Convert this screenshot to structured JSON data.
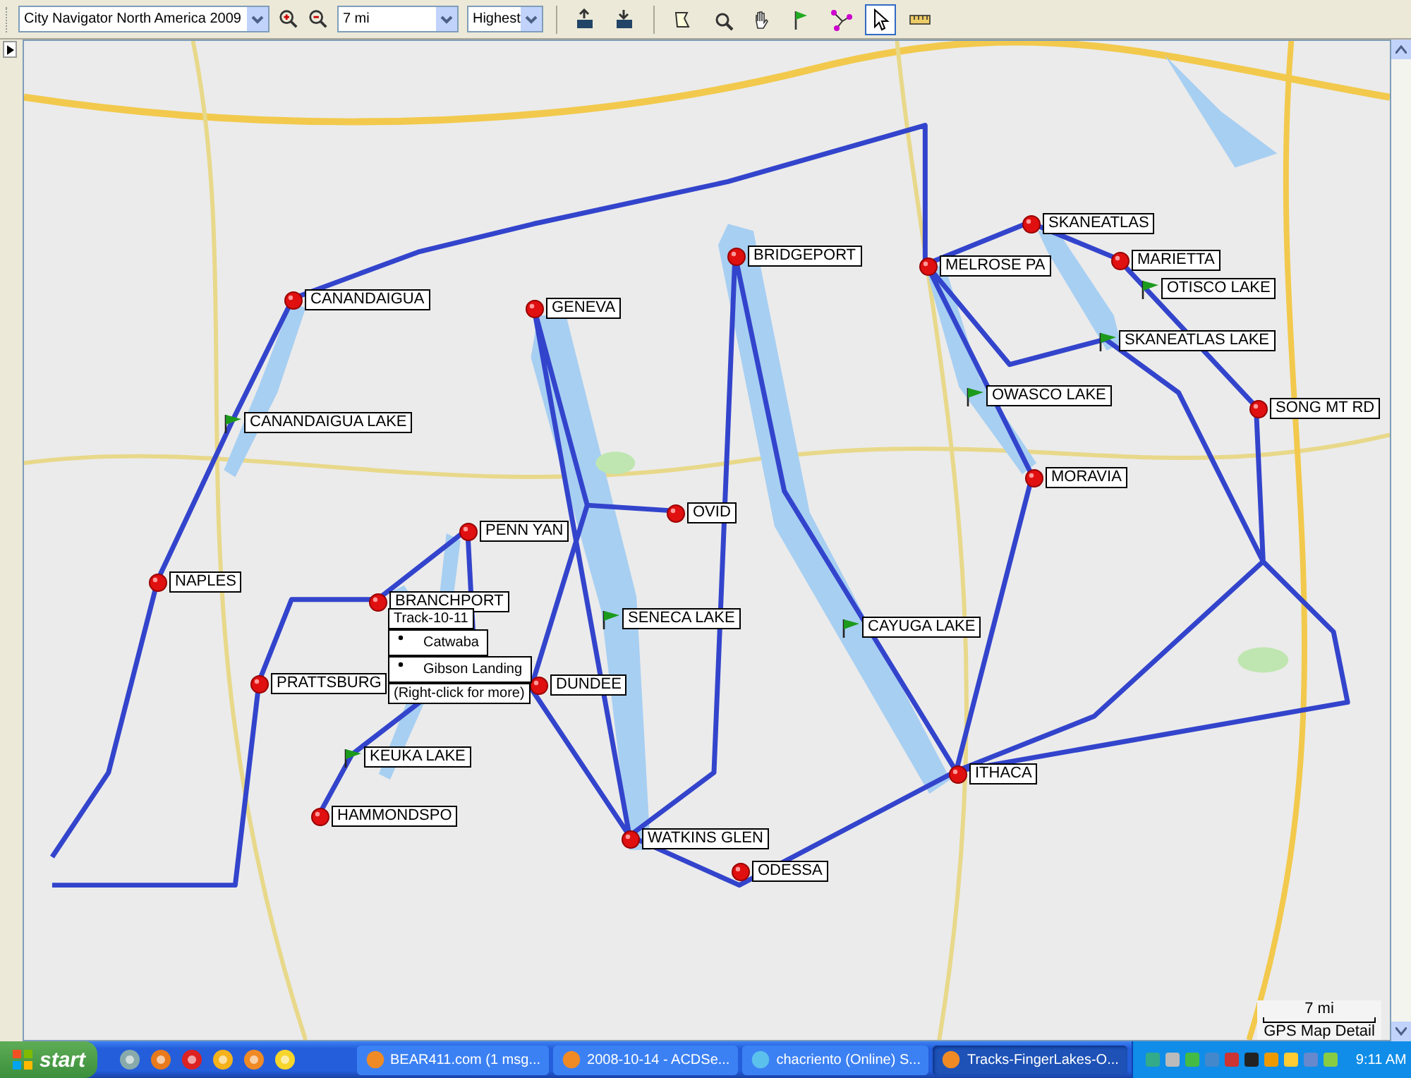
{
  "toolbar": {
    "map_product": "City Navigator North America 2009",
    "zoom_level": "7 mi",
    "detail": "Highest",
    "tools": [
      {
        "kind": "send",
        "selected": false
      },
      {
        "kind": "receive",
        "selected": false
      },
      {
        "kind": "polygon",
        "selected": false
      },
      {
        "kind": "zoom",
        "selected": false
      },
      {
        "kind": "hand",
        "selected": false
      },
      {
        "kind": "flag",
        "selected": false
      },
      {
        "kind": "route",
        "selected": false
      },
      {
        "kind": "pointer",
        "selected": true
      },
      {
        "kind": "ruler",
        "selected": false
      }
    ]
  },
  "map": {
    "kind": "picture",
    "waypoints": [
      {
        "label": "CANANDAIGUA",
        "kind": "city"
      },
      {
        "label": "GENEVA",
        "kind": "city"
      },
      {
        "label": "BRIDGEPORT",
        "kind": "city"
      },
      {
        "label": "MELROSE PA",
        "kind": "city"
      },
      {
        "label": "SKANEATLAS",
        "kind": "city"
      },
      {
        "label": "MARIETTA",
        "kind": "city"
      },
      {
        "label": "OTISCO LAKE",
        "kind": "lake"
      },
      {
        "label": "SKANEATLAS LAKE",
        "kind": "lake"
      },
      {
        "label": "SONG MT RD",
        "kind": "city"
      },
      {
        "label": "CANANDAIGUA LAKE",
        "kind": "lake"
      },
      {
        "label": "OWASCO LAKE",
        "kind": "lake"
      },
      {
        "label": "MORAVIA",
        "kind": "city"
      },
      {
        "label": "OVID",
        "kind": "city"
      },
      {
        "label": "PENN YAN",
        "kind": "city"
      },
      {
        "label": "NAPLES",
        "kind": "city"
      },
      {
        "label": "BRANCHPORT",
        "kind": "city"
      },
      {
        "label": "SENECA LAKE",
        "kind": "lake"
      },
      {
        "label": "CAYUGA LAKE",
        "kind": "lake"
      },
      {
        "label": "PRATTSBURG",
        "kind": "city"
      },
      {
        "label": "DUNDEE",
        "kind": "city"
      },
      {
        "label": "KEUKA LAKE",
        "kind": "lake"
      },
      {
        "label": "ITHACA",
        "kind": "city"
      },
      {
        "label": "HAMMONDSPO",
        "kind": "city"
      },
      {
        "label": "WATKINS GLEN",
        "kind": "city"
      },
      {
        "label": "ODESSA",
        "kind": "city"
      }
    ],
    "popup": {
      "title": "Track-10-11",
      "items": [
        "Catwaba",
        "Gibson Landing"
      ],
      "footer": "(Right-click for more)"
    },
    "scale": "7 mi",
    "detail_label": "GPS Map Detail"
  },
  "taskbar": {
    "start": "start",
    "tasks": [
      {
        "label": "BEAR411.com (1 msg...",
        "selected": false
      },
      {
        "label": "2008-10-14 - ACDSe...",
        "selected": false
      },
      {
        "label": "chacriento (Online) S...",
        "selected": false
      },
      {
        "label": "Tracks-FingerLakes-O...",
        "selected": true
      }
    ],
    "clock": "9:11 AM"
  }
}
